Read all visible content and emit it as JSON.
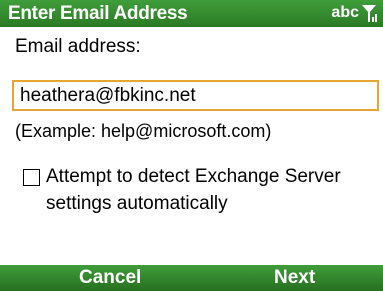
{
  "title_bar": {
    "title": "Enter Email Address",
    "input_mode": "abc",
    "signal_icon": "signal-strength-icon"
  },
  "form": {
    "email_label": "Email address:",
    "email_value": "heathera@fbkinc.net",
    "example_text": "(Example: help@microsoft.com)",
    "detect_checkbox": {
      "checked": false,
      "label": "Attempt to detect Exchange Server settings automatically"
    }
  },
  "soft_keys": {
    "left": "Cancel",
    "right": "Next"
  },
  "colors": {
    "bar_green": "#2b7a24",
    "input_border": "#e8a530"
  }
}
